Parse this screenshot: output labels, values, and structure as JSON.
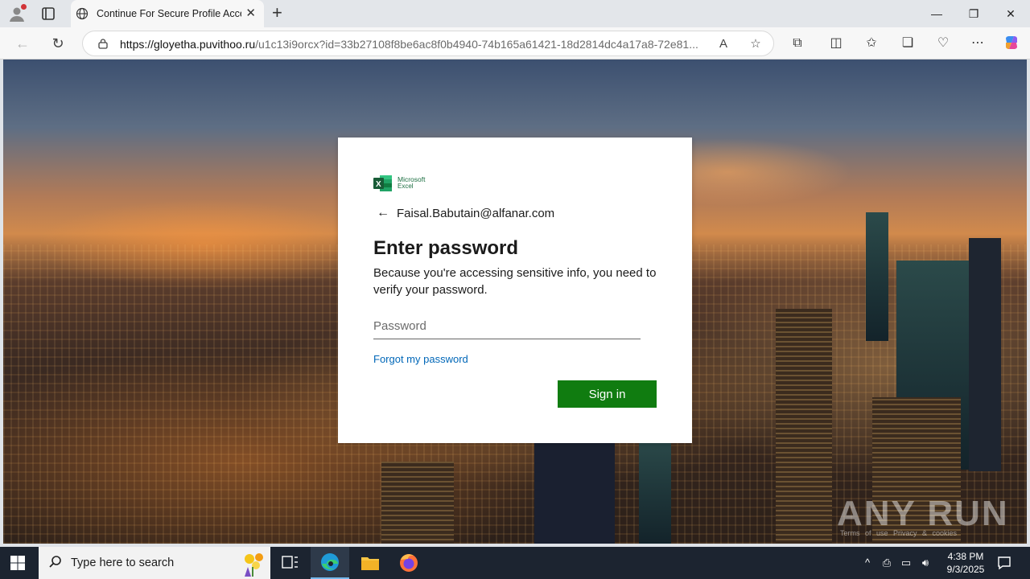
{
  "browser": {
    "tab_title": "Continue For Secure Profile Access",
    "url_host": "https://gloyetha.puvithoo.ru",
    "url_rest": "/u1c13i9orcx?id=33b27108f8be6ac8f0b4940-74b165a61421-18d2814dc4a17a8-72e81..."
  },
  "login": {
    "brand_line1": "Microsoft",
    "brand_line2": "Excel",
    "identity": "Faisal.Babutain@alfanar.com",
    "heading": "Enter password",
    "description": "Because you're accessing sensitive info, you need to verify your password.",
    "password_placeholder": "Password",
    "forgot_link": "Forgot my password",
    "signin_label": "Sign in",
    "accent_color": "#107c10",
    "link_color": "#0067b8"
  },
  "watermark": {
    "text": "ANY RUN",
    "sub": "Terms of use  Privacy & cookies"
  },
  "taskbar": {
    "search_placeholder": "Type here to search",
    "time": "4:38 PM",
    "date": "9/3/2025"
  }
}
